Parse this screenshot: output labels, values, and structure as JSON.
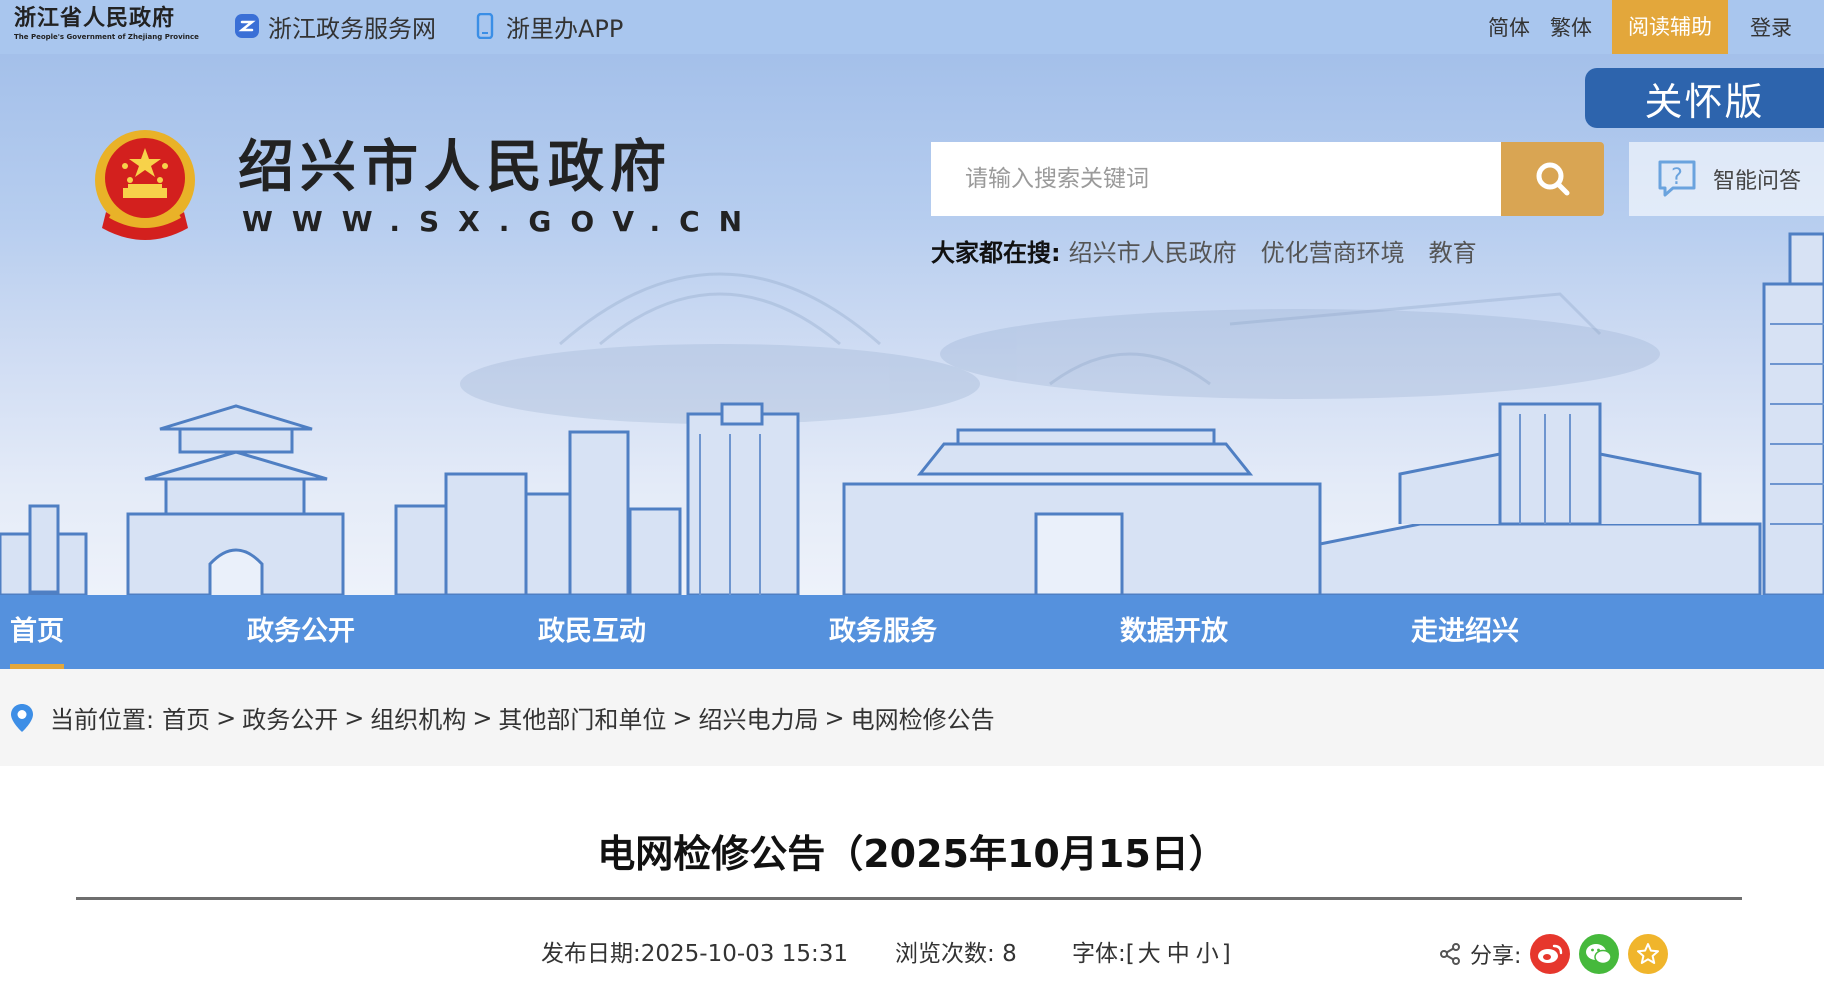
{
  "topbar": {
    "province_logo_cn": "浙江省人民政府",
    "province_logo_en": "The People's Government of Zhejiang Province",
    "links": [
      {
        "label": "浙江政务服务网",
        "icon": "zhejiang-service-icon"
      },
      {
        "label": "浙里办APP",
        "icon": "mobile-app-icon"
      }
    ],
    "right": {
      "simplified": "简体",
      "traditional": "繁体",
      "reading_aid": "阅读辅助",
      "login": "登录"
    },
    "colors": {
      "bar": "#a9c6ee",
      "reading_aid_bg": "#e3a73b"
    }
  },
  "header": {
    "care_version": "关怀版",
    "site_name": "绍兴市人民政府",
    "site_url": "WWW.SX.GOV.CN",
    "search": {
      "placeholder": "请输入搜索关键词",
      "button_icon": "search-icon"
    },
    "ai_qa": {
      "label": "智能问答",
      "icon": "question-chat-icon"
    },
    "hot_search": {
      "label": "大家都在搜:",
      "items": [
        "绍兴市人民政府",
        "优化营商环境",
        "教育"
      ]
    },
    "colors": {
      "care_bg": "#2d64ad",
      "search_btn": "#d9a553"
    }
  },
  "nav": {
    "items": [
      "首页",
      "政务公开",
      "政民互动",
      "政务服务",
      "数据开放",
      "走进绍兴"
    ],
    "active_index": 0,
    "colors": {
      "bg": "#5591dd",
      "active_underline": "#e3a73b"
    }
  },
  "breadcrumb": {
    "label": "当前位置:",
    "items": [
      "首页",
      "政务公开",
      "组织机构",
      "其他部门和单位",
      "绍兴电力局",
      "电网检修公告"
    ],
    "separator": ">"
  },
  "article": {
    "title": "电网检修公告（2025年10月15日）",
    "publish_label": "发布日期:",
    "publish_date": "2025-10-03 15:31",
    "views_label": "浏览次数:",
    "views": "8",
    "font_label": "字体:[",
    "font_sizes": [
      "大",
      "中",
      "小"
    ],
    "font_close": "]",
    "share_label": "分享:",
    "share_targets": [
      {
        "name": "weibo",
        "color": "#e6372d"
      },
      {
        "name": "wechat",
        "color": "#46b93c"
      },
      {
        "name": "favorite",
        "color": "#f0b52c"
      }
    ]
  }
}
